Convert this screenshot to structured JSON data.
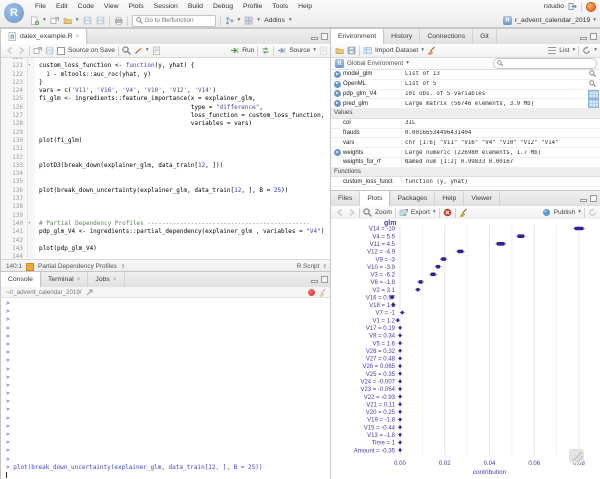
{
  "chrome": {
    "logo": "R",
    "menus": [
      "File",
      "Edit",
      "Code",
      "View",
      "Plots",
      "Session",
      "Build",
      "Debug",
      "Profile",
      "Tools",
      "Help"
    ],
    "right_text": "rstudio",
    "goto_placeholder": "Go to file/function",
    "addins": "Addins",
    "project": "r_advent_calendar_2019"
  },
  "source_pane": {
    "tab_title": "dalex_example.R",
    "source_on_save": "Source on Save",
    "run": "Run",
    "source": "Source",
    "status": {
      "position": "140:1",
      "section": "Partial Dependency Profiles",
      "doc_type": "R Script"
    },
    "code": {
      "first_line": 120,
      "fold_lines": [
        121,
        140
      ],
      "lines": [
        [],
        [
          [
            "p",
            "custom_loss_function <- "
          ],
          [
            "k",
            "function"
          ],
          [
            "p",
            "(y, yhat) {"
          ]
        ],
        [
          [
            "p",
            "  "
          ],
          [
            "n",
            "1"
          ],
          [
            "p",
            " - mltools::auc_roc(yhat, y)"
          ]
        ],
        [
          [
            "p",
            "}"
          ]
        ],
        [
          [
            "p",
            "vars = c("
          ],
          [
            "s",
            "'V11'"
          ],
          [
            "p",
            ", "
          ],
          [
            "s",
            "'V16'"
          ],
          [
            "p",
            ", "
          ],
          [
            "s",
            "'V4'"
          ],
          [
            "p",
            ", "
          ],
          [
            "s",
            "'V10'"
          ],
          [
            "p",
            ", "
          ],
          [
            "s",
            "'V12'"
          ],
          [
            "p",
            ", "
          ],
          [
            "s",
            "'V14'"
          ],
          [
            "p",
            ")"
          ]
        ],
        [
          [
            "p",
            "fi_glm <- ingredients::feature_importance(x = explainer_glm,"
          ]
        ],
        [
          [
            "p",
            "                                          type = "
          ],
          [
            "s",
            "\"difference\""
          ],
          [
            "p",
            ","
          ]
        ],
        [
          [
            "p",
            "                                          loss_function = custom_loss_function,"
          ]
        ],
        [
          [
            "p",
            "                                          variables = vars)"
          ]
        ],
        [],
        [
          [
            "p",
            "plot(fi_glm)"
          ]
        ],
        [],
        [],
        [
          [
            "p",
            "plotD3(break_down(explainer_glm, data_train["
          ],
          [
            "n",
            "12"
          ],
          [
            "p",
            ", ]))"
          ]
        ],
        [],
        [],
        [
          [
            "p",
            "plot(break_down_uncertainty(explainer_glm, data_train["
          ],
          [
            "n",
            "12"
          ],
          [
            "p",
            ", ], B = "
          ],
          [
            "n",
            "25"
          ],
          [
            "p",
            "))"
          ]
        ],
        [],
        [],
        [],
        [
          [
            "c",
            "# Partial Dependency Profiles ---------------------------------------------"
          ]
        ],
        [
          [
            "p",
            "pdp_glm_V4 <- ingredients::partial_dependency(explainer_glm , variables = "
          ],
          [
            "s",
            "\"V4\""
          ],
          [
            "p",
            ")"
          ]
        ],
        [],
        [
          [
            "p",
            "plot(pdp_glm_V4)"
          ]
        ],
        []
      ]
    }
  },
  "console_pane": {
    "tabs": [
      "Console",
      "Terminal",
      "Jobs"
    ],
    "active_tab": "Console",
    "path": "~/r_advent_calendar_2019/",
    "prompt": ">",
    "prompt_count": 20,
    "command": "plot(break_down_uncertainty(explainer_glm, data_train[12, ], B = 25))"
  },
  "environment_pane": {
    "tabs": [
      "Environment",
      "History",
      "Connections",
      "Git"
    ],
    "active_tab": "Environment",
    "import_dataset": "Import Dataset",
    "list_label": "List",
    "scope": "Global Environment",
    "sections": [
      {
        "header": "",
        "rows": [
          {
            "name": "model_glm",
            "value": "List of 13",
            "expand": true,
            "action": "magnifier"
          },
          {
            "name": "OpenML",
            "value": "List of 5",
            "expand": true,
            "action": "magnifier"
          },
          {
            "name": "pdp_glm_V4",
            "value": "101 obs. of 5 variables",
            "expand": true,
            "action": "table"
          },
          {
            "name": "pred_glm",
            "value": "Large matrix (56746 elements, 3.9 Mb)",
            "expand": true,
            "action": "table"
          }
        ]
      },
      {
        "header": "Values",
        "rows": [
          {
            "name": "col",
            "value": "31L"
          },
          {
            "name": "frauds",
            "value": "0.00166534496431404"
          },
          {
            "name": "vars",
            "value": "chr [1:6] \"V11\" \"V16\" \"V4\" \"V10\" \"V12\" \"V14\""
          },
          {
            "name": "weights",
            "value": "Large numeric (226980 elements, 1.7 Mb)",
            "expand": true
          },
          {
            "name": "weights_for_rf",
            "value": "Named num [1:2] 0.99833 0.00167"
          }
        ]
      },
      {
        "header": "Functions",
        "rows": [
          {
            "name": "custom_loss_funct",
            "value": "function (y, yhat)",
            "clipped": true
          }
        ]
      }
    ]
  },
  "plots_pane": {
    "tabs": [
      "Files",
      "Plots",
      "Packages",
      "Help",
      "Viewer"
    ],
    "active_tab": "Plots",
    "zoom_label": "Zoom",
    "export_label": "Export",
    "publish_label": "Publish"
  },
  "chart_data": {
    "type": "boxplot-horizontal",
    "title": "glm",
    "xlabel": "contribution",
    "x_ticks": [
      0.0,
      0.02,
      0.04,
      0.06,
      0.08
    ],
    "x_tick_labels": [
      "0.00",
      "0.02",
      "0.04",
      "0.06",
      "0.08"
    ],
    "xlim": [
      -0.005,
      0.0855
    ],
    "accent_color": "#453aa8",
    "box_color": "#2d2391",
    "rows": [
      {
        "label": "V14 = -10",
        "median": 0.08,
        "q1": 0.078,
        "q3": 0.082
      },
      {
        "label": "V4 = 5.5",
        "median": 0.054,
        "q1": 0.0525,
        "q3": 0.0555
      },
      {
        "label": "V11 = 4.5",
        "median": 0.045,
        "q1": 0.0432,
        "q3": 0.0468
      },
      {
        "label": "V12 = -4.9",
        "median": 0.027,
        "q1": 0.0257,
        "q3": 0.0283
      },
      {
        "label": "V9 = -3",
        "median": 0.0195,
        "q1": 0.0184,
        "q3": 0.0206
      },
      {
        "label": "V10 = -3.9",
        "median": 0.017,
        "q1": 0.0161,
        "q3": 0.0179
      },
      {
        "label": "V3 = -6.2",
        "median": 0.0148,
        "q1": 0.0137,
        "q3": 0.0159
      },
      {
        "label": "V6 = -1.8",
        "median": 0.0092,
        "q1": 0.0083,
        "q3": 0.0101
      },
      {
        "label": "V2 = 3.1",
        "median": 0.008,
        "q1": 0.0073,
        "q3": 0.0087
      },
      {
        "label": "V16 = 0.57",
        "median": -0.0036,
        "q1": -0.0043,
        "q3": -0.0029
      },
      {
        "label": "V18 = 1.6",
        "median": -0.003,
        "q1": -0.0036,
        "q3": -0.0024
      },
      {
        "label": "V7 = -1",
        "median": 0.001,
        "q1": 0.0005,
        "q3": 0.0015
      },
      {
        "label": "V1 = 1.2",
        "median": -0.001,
        "q1": -0.0015,
        "q3": -0.0005
      },
      {
        "label": "V17 = 0.19",
        "median": 0.0,
        "q1": -0.0004,
        "q3": 0.0004
      },
      {
        "label": "V8 = 0.34",
        "median": 0.0,
        "q1": -0.0004,
        "q3": 0.0004
      },
      {
        "label": "V5 = 1.6",
        "median": 0.0,
        "q1": -0.0004,
        "q3": 0.0004
      },
      {
        "label": "V28 = 0.32",
        "median": 0.0,
        "q1": -0.0004,
        "q3": 0.0004
      },
      {
        "label": "V27 = 0.48",
        "median": 0.0,
        "q1": -0.0004,
        "q3": 0.0004
      },
      {
        "label": "V26 = 0.065",
        "median": 0.0,
        "q1": -0.0004,
        "q3": 0.0004
      },
      {
        "label": "V25 = 0.35",
        "median": 0.0,
        "q1": -0.0004,
        "q3": 0.0004
      },
      {
        "label": "V24 = -0.007",
        "median": 0.0,
        "q1": -0.0004,
        "q3": 0.0004
      },
      {
        "label": "V23 = -0.064",
        "median": 0.0,
        "q1": -0.0004,
        "q3": 0.0004
      },
      {
        "label": "V22 = -0.93",
        "median": 0.0,
        "q1": -0.0004,
        "q3": 0.0004
      },
      {
        "label": "V21 = 0.11",
        "median": 0.0,
        "q1": -0.0004,
        "q3": 0.0004
      },
      {
        "label": "V20 = 0.25",
        "median": 0.0,
        "q1": -0.0004,
        "q3": 0.0004
      },
      {
        "label": "V19 = -1.8",
        "median": 0.0,
        "q1": -0.0004,
        "q3": 0.0004
      },
      {
        "label": "V15 = -0.44",
        "median": 0.0,
        "q1": -0.0004,
        "q3": 0.0004
      },
      {
        "label": "V13 = -1.8",
        "median": 0.0,
        "q1": -0.0004,
        "q3": 0.0004
      },
      {
        "label": "Time = 1",
        "median": 0.0,
        "q1": -0.0004,
        "q3": 0.0004
      },
      {
        "label": "Amount = -0.35",
        "median": 0.0,
        "q1": -0.0004,
        "q3": 0.0004
      }
    ]
  }
}
